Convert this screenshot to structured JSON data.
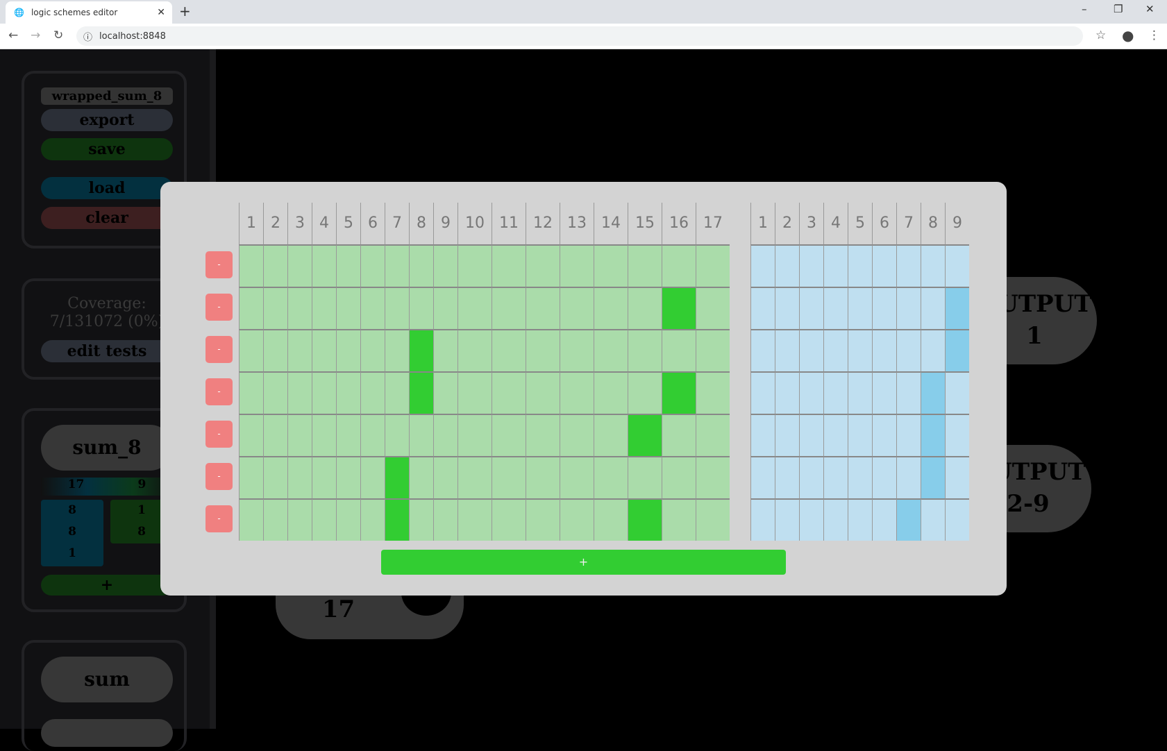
{
  "browser": {
    "tab_title": "logic schemes editor",
    "url": "localhost:8848"
  },
  "sidebar": {
    "scheme_name": "wrapped_sum_8",
    "export": "export",
    "save": "save",
    "load": "load",
    "clear": "clear",
    "coverage_label": "Coverage:",
    "coverage_value": "7/131072 (0%)",
    "edit_tests": "edit tests",
    "component": {
      "name": "sum_8",
      "inputs_count": "17",
      "outputs_count": "9",
      "inputs": [
        "8",
        "8",
        "1"
      ],
      "outputs": [
        "1",
        "8"
      ],
      "add": "+"
    },
    "component2": {
      "name": "sum"
    }
  },
  "canvas": {
    "output1": [
      "OUTPUT",
      "1"
    ],
    "output2": [
      "OUTPUT",
      "2-9"
    ],
    "input_node": "17"
  },
  "tests": {
    "input_headers": [
      "1",
      "2",
      "3",
      "4",
      "5",
      "6",
      "7",
      "8",
      "9",
      "10",
      "11",
      "12",
      "13",
      "14",
      "15",
      "16",
      "17"
    ],
    "output_headers": [
      "1",
      "2",
      "3",
      "4",
      "5",
      "6",
      "7",
      "8",
      "9"
    ],
    "rows": [
      {
        "inputs_on": [],
        "outputs_on": []
      },
      {
        "inputs_on": [
          16
        ],
        "outputs_on": [
          9
        ]
      },
      {
        "inputs_on": [
          8
        ],
        "outputs_on": [
          9
        ]
      },
      {
        "inputs_on": [
          8,
          16
        ],
        "outputs_on": [
          8
        ]
      },
      {
        "inputs_on": [
          15
        ],
        "outputs_on": [
          8
        ]
      },
      {
        "inputs_on": [
          7
        ],
        "outputs_on": [
          8
        ]
      },
      {
        "inputs_on": [
          7,
          15
        ],
        "outputs_on": [
          7
        ]
      }
    ],
    "remove_label": "-",
    "add_label": "+",
    "colors": {
      "input_off": "#aadcaa",
      "input_on": "#32cd32",
      "output_off": "#bfdff0",
      "output_on": "#87cdea",
      "remove": "#f08080"
    }
  }
}
